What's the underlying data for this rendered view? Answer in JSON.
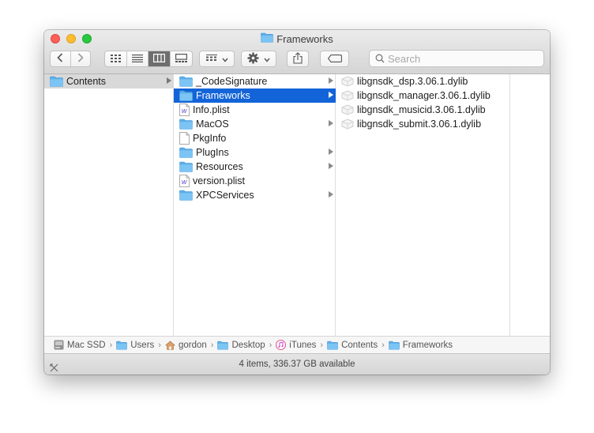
{
  "window": {
    "title": "Frameworks"
  },
  "toolbar": {
    "back_icon": "chevron-left-icon",
    "forward_icon": "chevron-right-icon",
    "view_modes": [
      "icon-view-icon",
      "list-view-icon",
      "column-view-icon",
      "gallery-view-icon"
    ],
    "active_view": "column-view-icon",
    "group_icon": "group-by-icon",
    "action_icon": "gear-icon",
    "share_icon": "share-icon",
    "tag_icon": "tag-icon",
    "search_placeholder": "Search"
  },
  "columns": {
    "col1": [
      {
        "label": "Contents",
        "icon": "folder-icon",
        "has_children": true,
        "state": "dim"
      }
    ],
    "col2": [
      {
        "label": "_CodeSignature",
        "icon": "folder-icon",
        "has_children": true,
        "state": ""
      },
      {
        "label": "Frameworks",
        "icon": "folder-icon",
        "has_children": true,
        "state": "selected"
      },
      {
        "label": "Info.plist",
        "icon": "plist-file-icon",
        "has_children": false,
        "state": ""
      },
      {
        "label": "MacOS",
        "icon": "folder-icon",
        "has_children": true,
        "state": ""
      },
      {
        "label": "PkgInfo",
        "icon": "blank-file-icon",
        "has_children": false,
        "state": ""
      },
      {
        "label": "PlugIns",
        "icon": "folder-icon",
        "has_children": true,
        "state": ""
      },
      {
        "label": "Resources",
        "icon": "folder-icon",
        "has_children": true,
        "state": ""
      },
      {
        "label": "version.plist",
        "icon": "plist-file-icon",
        "has_children": false,
        "state": ""
      },
      {
        "label": "XPCServices",
        "icon": "folder-icon",
        "has_children": true,
        "state": ""
      }
    ],
    "col3": [
      {
        "label": "libgnsdk_dsp.3.06.1.dylib",
        "icon": "dylib-file-icon"
      },
      {
        "label": "libgnsdk_manager.3.06.1.dylib",
        "icon": "dylib-file-icon"
      },
      {
        "label": "libgnsdk_musicid.3.06.1.dylib",
        "icon": "dylib-file-icon"
      },
      {
        "label": "libgnsdk_submit.3.06.1.dylib",
        "icon": "dylib-file-icon"
      }
    ]
  },
  "pathbar": {
    "items": [
      {
        "label": "Mac SSD",
        "icon": "drive-icon"
      },
      {
        "label": "Users",
        "icon": "folder-icon"
      },
      {
        "label": "gordon",
        "icon": "home-icon"
      },
      {
        "label": "Desktop",
        "icon": "folder-icon"
      },
      {
        "label": "iTunes",
        "icon": "itunes-icon"
      },
      {
        "label": "Contents",
        "icon": "folder-icon"
      },
      {
        "label": "Frameworks",
        "icon": "folder-icon"
      }
    ]
  },
  "status": {
    "text": "4 items, 336.37 GB available",
    "icon": "hide-sidebar-icon"
  },
  "colors": {
    "selection": "#1364d9",
    "folder": "#6cb6ee"
  }
}
